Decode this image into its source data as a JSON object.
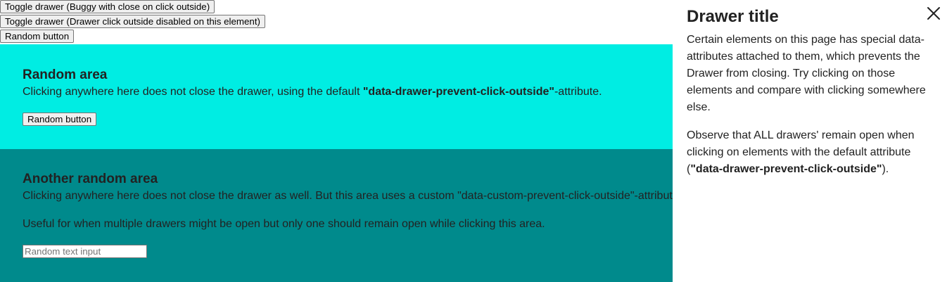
{
  "top_buttons": {
    "toggle_buggy": "Toggle drawer (Buggy with close on click outside)",
    "toggle_disabled": "Toggle drawer (Drawer click outside disabled on this element)",
    "random": "Random button"
  },
  "random_area": {
    "title": "Random area",
    "desc_before": "Clicking anywhere here does not close the drawer, using the default ",
    "desc_attr": "\"data-drawer-prevent-click-outside\"",
    "desc_after": "-attribute.",
    "button": "Random button",
    "bg_color": "#00ede3"
  },
  "another_area": {
    "title": "Another random area",
    "desc": "Clicking anywhere here does not close the drawer as well. But this area uses a custom \"data-custom-prevent-click-outside\"-attribute.",
    "note": "Useful for when multiple drawers might be open but only one should remain open while clicking this area.",
    "input_placeholder": "Random text input",
    "bg_color": "#008a8c"
  },
  "drawer": {
    "title": "Drawer title",
    "p1": "Certain elements on this page has special data-attributes attached to them, which prevents the Drawer from closing. Try clicking on those elements and compare with clicking somewhere else.",
    "p2_before": "Observe that ALL drawers' remain open when clicking on elements with the default attribute (",
    "p2_attr": "\"data-drawer-prevent-click-outside\"",
    "p2_after": ").",
    "close_icon": "close-icon"
  }
}
